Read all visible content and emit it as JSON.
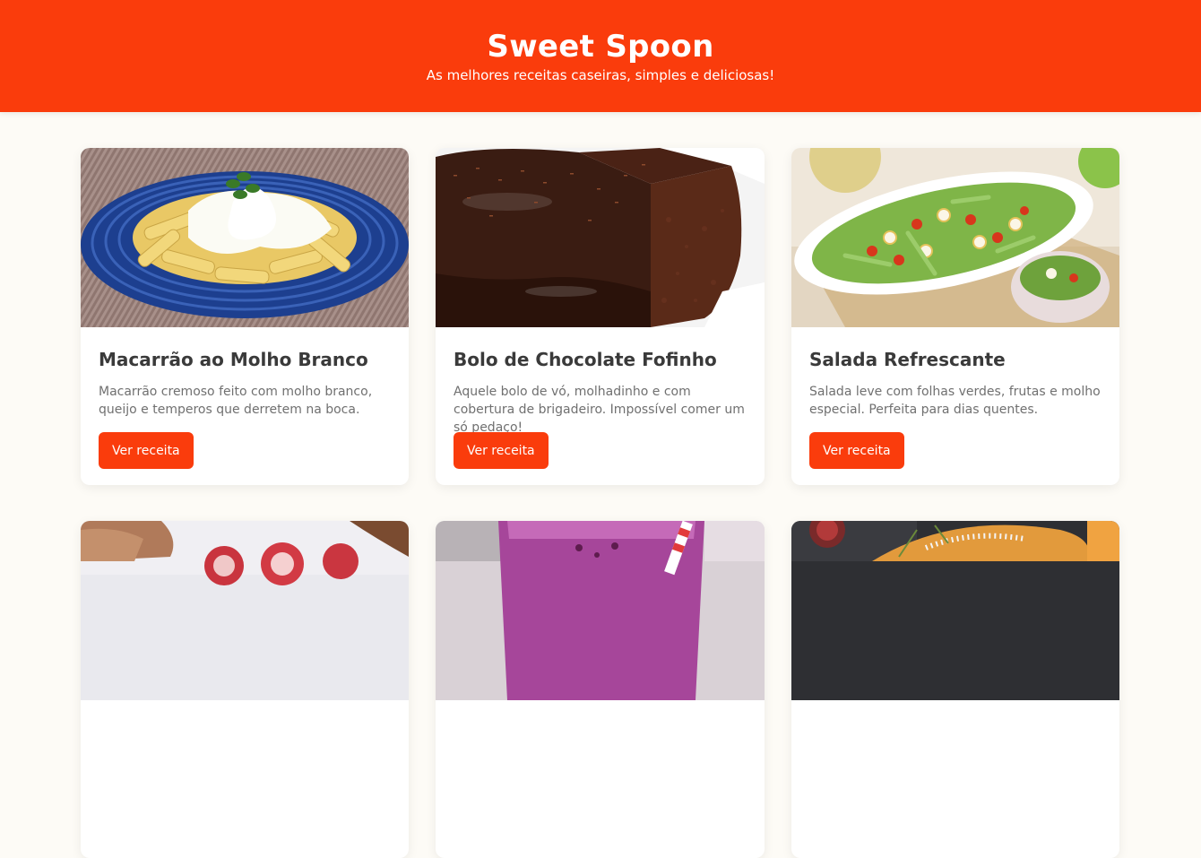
{
  "header": {
    "title": "Sweet Spoon",
    "subtitle": "As melhores receitas caseiras, simples e deliciosas!"
  },
  "colors": {
    "brand": "#fa3c0c",
    "background": "#fdfbf6",
    "card_title": "#3a3a3a",
    "card_text": "#707070"
  },
  "recipes": [
    {
      "title": "Macarrão ao Molho Branco",
      "description": "Macarrão cremoso feito com molho branco, queijo e temperos que derretem na boca.",
      "button_label": "Ver receita",
      "image": "pasta-white-sauce-photo"
    },
    {
      "title": "Bolo de Chocolate Fofinho",
      "description": "Aquele bolo de vó, molhadinho e com cobertura de brigadeiro. Impossível comer um só pedaço!",
      "button_label": "Ver receita",
      "image": "chocolate-cake-photo"
    },
    {
      "title": "Salada Refrescante",
      "description": "Salada leve com folhas verdes, frutas e molho especial. Perfeita para dias quentes.",
      "button_label": "Ver receita",
      "image": "fresh-salad-photo"
    },
    {
      "image": "strawberry-dessert-photo"
    },
    {
      "image": "berry-smoothie-photo"
    },
    {
      "image": "baked-dish-photo"
    }
  ]
}
